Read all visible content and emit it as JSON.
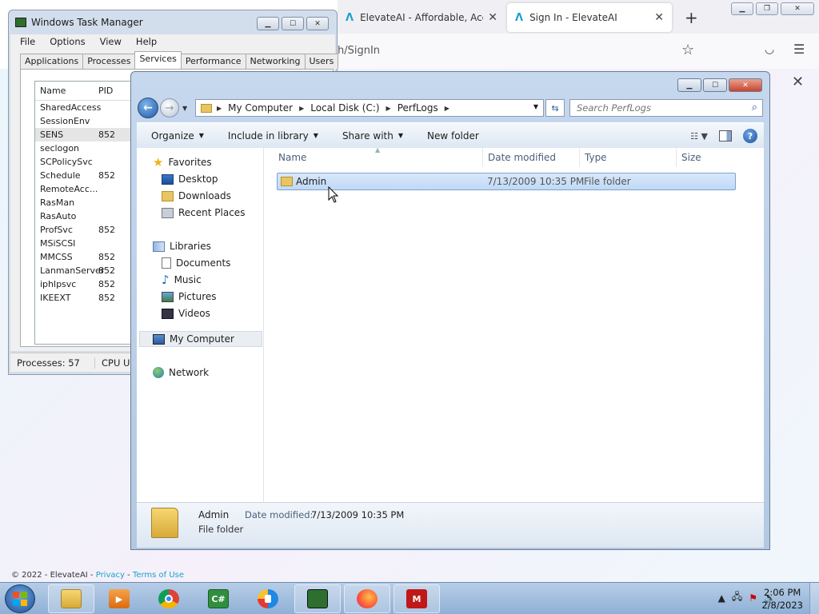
{
  "browser": {
    "tabs": [
      {
        "title": "ElevateAI - Affordable, Accur",
        "active": false
      },
      {
        "title": "Sign In - ElevateAI",
        "active": true
      }
    ],
    "url_visible": "h/SignIn",
    "footer_copyright": "© 2022 - ElevateAI - ",
    "footer_privacy": "Privacy",
    "footer_sep": " - ",
    "footer_terms": "Terms of Use"
  },
  "taskmgr": {
    "title": "Windows Task Manager",
    "menu": [
      "File",
      "Options",
      "View",
      "Help"
    ],
    "tabs": [
      "Applications",
      "Processes",
      "Services",
      "Performance",
      "Networking",
      "Users"
    ],
    "active_tab": "Services",
    "columns": [
      "Name",
      "PID"
    ],
    "rows": [
      {
        "name": "SharedAccess",
        "pid": ""
      },
      {
        "name": "SessionEnv",
        "pid": ""
      },
      {
        "name": "SENS",
        "pid": "852"
      },
      {
        "name": "seclogon",
        "pid": ""
      },
      {
        "name": "SCPolicySvc",
        "pid": ""
      },
      {
        "name": "Schedule",
        "pid": "852"
      },
      {
        "name": "RemoteAcc...",
        "pid": ""
      },
      {
        "name": "RasMan",
        "pid": ""
      },
      {
        "name": "RasAuto",
        "pid": ""
      },
      {
        "name": "ProfSvc",
        "pid": "852"
      },
      {
        "name": "MSiSCSI",
        "pid": ""
      },
      {
        "name": "MMCSS",
        "pid": "852"
      },
      {
        "name": "LanmanServer",
        "pid": "852"
      },
      {
        "name": "iphlpsvc",
        "pid": "852"
      },
      {
        "name": "IKEEXT",
        "pid": "852"
      }
    ],
    "status_processes": "Processes: 57",
    "status_cpu": "CPU Us"
  },
  "explorer": {
    "breadcrumb": [
      "My Computer",
      "Local Disk (C:)",
      "PerfLogs"
    ],
    "search_placeholder": "Search PerfLogs",
    "commands": [
      "Organize",
      "Include in library",
      "Share with",
      "New folder"
    ],
    "nav": {
      "favorites": "Favorites",
      "favorites_items": [
        "Desktop",
        "Downloads",
        "Recent Places"
      ],
      "libraries": "Libraries",
      "libraries_items": [
        "Documents",
        "Music",
        "Pictures",
        "Videos"
      ],
      "computer": "My Computer",
      "network": "Network"
    },
    "columns": [
      "Name",
      "Date modified",
      "Type",
      "Size"
    ],
    "files": [
      {
        "name": "Admin",
        "date": "7/13/2009 10:35 PM",
        "type": "File folder",
        "size": ""
      }
    ],
    "details": {
      "name": "Admin",
      "modified_label": "Date modified:",
      "modified_value": "7/13/2009 10:35 PM",
      "type": "File folder"
    }
  },
  "taskbar": {
    "apps": [
      "file-explorer",
      "media-player",
      "chrome",
      "csharp-editor",
      "security-app",
      "task-manager",
      "firefox",
      "mcafee"
    ],
    "time": "2:06 PM",
    "date": "2/8/2023"
  },
  "colors": {
    "accent": "#1aa2c9",
    "selection": "#cde3f8"
  }
}
